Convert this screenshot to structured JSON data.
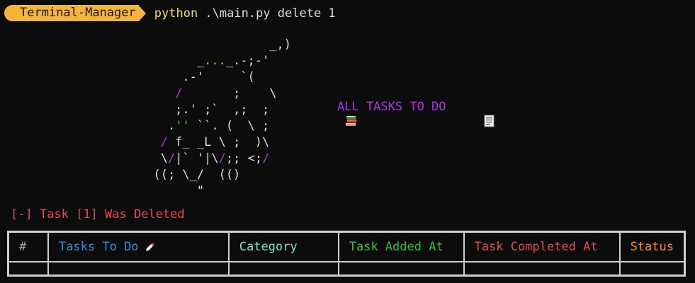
{
  "prompt": {
    "badge": "Terminal-Manager",
    "command_exe": "python",
    "command_args": " .\\main.py delete 1"
  },
  "ascii_art": {
    "line1": "                  _,)",
    "line2a": "        _",
    "line2b": "...",
    "line2c": "_.-;-'",
    "line3": "      .-'     `(",
    "line4a": "     ",
    "line4b": "/",
    "line4c": "       ;    \\",
    "line5": "     ;.' ;`  ,;  ;",
    "line6a": "    .",
    "line6b": "''",
    "line6c": " ``. (  \\ ;",
    "line7a": "   ",
    "line7b": "/",
    "line7c": " f_ _L \\ ;  )\\",
    "line8a": "   \\",
    "line8b": "/",
    "line8c": "|` '|\\",
    "line8d": "/",
    "line8e": ";; <;",
    "line8f": "/",
    "line9": "  ((; \\_/  (()",
    "line10": "        \""
  },
  "heading": {
    "text": "ALL TASKS TO DO",
    "left_icon": "books-icon",
    "right_icon": "scroll-icon"
  },
  "status_message": "[-] Task [1] Was Deleted",
  "table": {
    "columns": {
      "num": "#",
      "task": "Tasks To Do",
      "category": "Category",
      "added": "Task Added At",
      "completed": "Task Completed At",
      "status": "Status"
    },
    "task_icon": "pencil-icon"
  },
  "colors": {
    "badge": "#f7b538",
    "heading": "#b62cf0",
    "deleted": "#e74856",
    "task_header": "#2a8de0",
    "category_header": "#7ee8c4",
    "added_header": "#2fc02f",
    "completed_header": "#e74856",
    "status_header": "#ff8c1a"
  }
}
